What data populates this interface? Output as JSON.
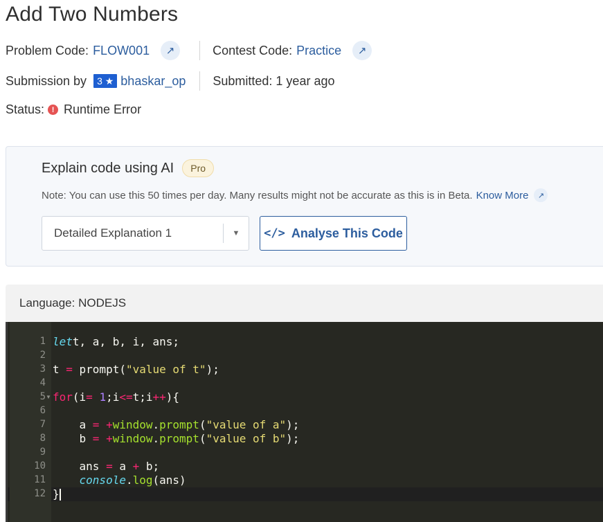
{
  "problem": {
    "title": "Add Two Numbers",
    "code_label": "Problem Code:",
    "code": "FLOW001",
    "contest_label": "Contest Code:",
    "contest": "Practice"
  },
  "submission": {
    "by_label": "Submission by",
    "rating": "3 ★",
    "user": "bhaskar_op",
    "submitted": "Submitted: 1 year ago",
    "status_label": "Status:",
    "status": "Runtime Error"
  },
  "ai": {
    "title": "Explain code using AI",
    "badge": "Pro",
    "note": "Note: You can use this 50 times per day. Many results might not be accurate as this is in Beta.",
    "know_more": "Know More",
    "select_value": "Detailed Explanation 1",
    "button_label": "Analyse This Code"
  },
  "language": {
    "label": "Language: NODEJS"
  },
  "editor": {
    "line_numbers": [
      "1",
      "2",
      "3",
      "4",
      "5",
      "6",
      "7",
      "8",
      "9",
      "10",
      "11",
      "12"
    ],
    "lines": [
      [
        [
          "kw-i",
          "let"
        ],
        [
          "",
          "t, a, b, i, ans;"
        ]
      ],
      [],
      [
        [
          "",
          "t "
        ],
        [
          "op",
          "="
        ],
        [
          "",
          ""
        ],
        [
          "",
          "prompt("
        ],
        [
          "str",
          "\"value of t\""
        ],
        [
          "",
          ");"
        ]
      ],
      [],
      [
        [
          "kw",
          "for"
        ],
        [
          "",
          "(i"
        ],
        [
          "op",
          "="
        ],
        [
          "num",
          "1"
        ],
        [
          "",
          ";i"
        ],
        [
          "op",
          "<="
        ],
        [
          "",
          "t;i"
        ],
        [
          "op",
          "++"
        ],
        [
          "",
          "){"
        ]
      ],
      [],
      [
        [
          "",
          "    a "
        ],
        [
          "op",
          "="
        ],
        [
          "",
          ""
        ],
        [
          "op",
          "+"
        ],
        [
          "fn",
          "window"
        ],
        [
          "",
          "."
        ],
        [
          "fn",
          "prompt"
        ],
        [
          "",
          "("
        ],
        [
          "str",
          "\"value of a\""
        ],
        [
          "",
          ");"
        ]
      ],
      [
        [
          "",
          "    b "
        ],
        [
          "op",
          "="
        ],
        [
          "",
          ""
        ],
        [
          "op",
          "+"
        ],
        [
          "fn",
          "window"
        ],
        [
          "",
          "."
        ],
        [
          "fn",
          "prompt"
        ],
        [
          "",
          "("
        ],
        [
          "str",
          "\"value of b\""
        ],
        [
          "",
          ");"
        ]
      ],
      [],
      [
        [
          "",
          "    ans "
        ],
        [
          "op",
          "="
        ],
        [
          "",
          "a "
        ],
        [
          "op",
          "+"
        ],
        [
          "",
          "b;"
        ]
      ],
      [
        [
          "",
          "    "
        ],
        [
          "obj",
          "console"
        ],
        [
          "",
          "."
        ],
        [
          "fn",
          "log"
        ],
        [
          "",
          "(ans)"
        ]
      ],
      [
        [
          "",
          "}"
        ]
      ]
    ]
  },
  "colors": {
    "link": "#2c5d9e",
    "rating_bg": "#1e5fd1",
    "error": "#e55353",
    "editor_bg": "#272822"
  },
  "icons": {
    "external": "arrow-up-right-icon",
    "status": "error-circle-icon",
    "caret": "chevron-down-icon",
    "code": "code-brackets-icon"
  }
}
